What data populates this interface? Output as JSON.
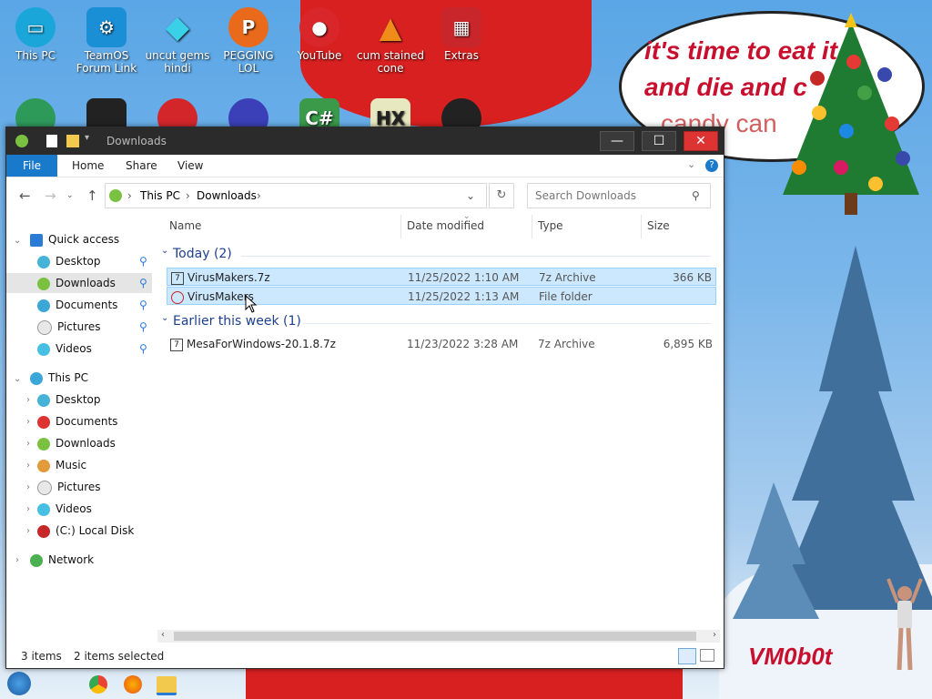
{
  "desktop": {
    "icons_top": [
      {
        "label": "This PC",
        "icon": "monitor-icon",
        "color": "#1aa6d9"
      },
      {
        "label": "TeamOS Forum Link",
        "icon": "gear-icon",
        "color": "#1b8fd6"
      },
      {
        "label": "uncut gems hindi",
        "icon": "gem-icon",
        "color": "#3ad0e8"
      },
      {
        "label": "PEGGING LOL",
        "icon": "p-logo-icon",
        "color": "#e86a1a"
      },
      {
        "label": "YouTube",
        "icon": "angry-bird-icon",
        "color": "#d9262b"
      },
      {
        "label": "cum stained cone",
        "icon": "cone-icon",
        "color": "#f08c1a"
      },
      {
        "label": "Extras",
        "icon": "gift-icon",
        "color": "#c9262b"
      }
    ],
    "bubble_text": [
      "it's time to eat it",
      "and die and c",
      "candy can"
    ],
    "signature": "VM0b0t"
  },
  "window": {
    "title": "Downloads",
    "ribbon": [
      "File",
      "Home",
      "Share",
      "View"
    ],
    "breadcrumb": [
      "This PC",
      "Downloads"
    ],
    "search_placeholder": "Search Downloads",
    "columns": [
      "Name",
      "Date modified",
      "Type",
      "Size"
    ],
    "nav_pane": {
      "quick_access": "Quick access",
      "quick_items": [
        "Desktop",
        "Downloads",
        "Documents",
        "Pictures",
        "Videos"
      ],
      "this_pc": "This PC",
      "pc_items": [
        "Desktop",
        "Documents",
        "Downloads",
        "Music",
        "Pictures",
        "Videos",
        "(C:) Local Disk"
      ],
      "network": "Network"
    },
    "groups": [
      {
        "label": "Today (2)",
        "files": [
          {
            "name": "VirusMakers.7z",
            "date": "11/25/2022 1:10 AM",
            "type": "7z Archive",
            "size": "366 KB",
            "selected": true
          },
          {
            "name": "VirusMakers",
            "date": "11/25/2022 1:13 AM",
            "type": "File folder",
            "size": "",
            "selected": true
          }
        ]
      },
      {
        "label": "Earlier this week (1)",
        "files": [
          {
            "name": "MesaForWindows-20.1.8.7z",
            "date": "11/23/2022 3:28 AM",
            "type": "7z Archive",
            "size": "6,895 KB",
            "selected": false
          }
        ]
      }
    ],
    "status": {
      "items": "3 items",
      "selected": "2 items selected"
    }
  }
}
